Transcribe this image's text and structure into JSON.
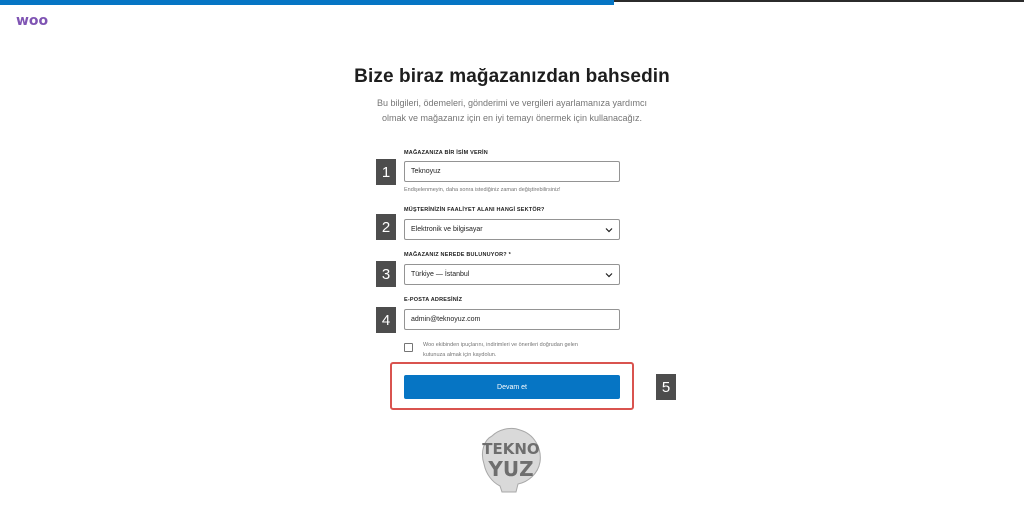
{
  "brand": {
    "logo_text": "woo",
    "logo_color": "#7f54b3",
    "accent_color": "#0675c4"
  },
  "page": {
    "title": "Bize biraz mağazanızdan bahsedin",
    "subtitle_line1": "Bu bilgileri, ödemeleri, gönderimi ve vergileri ayarlamanıza yardımcı",
    "subtitle_line2": "olmak ve mağazanız için en iyi temayı önermek için kullanacağız."
  },
  "form": {
    "store_name": {
      "label": "MAĞAZANIZA BİR İSİM VERİN",
      "value": "Teknoyuz",
      "help": "Endişelenmeyin, daha sonra istediğiniz zaman değiştirebilirsiniz!"
    },
    "industry": {
      "label": "MÜŞTERİNİZİN FAALİYET ALANI HANGİ SEKTÖR?",
      "value": "Elektronik ve bilgisayar"
    },
    "location": {
      "label": "MAĞAZANIZ NEREDE BULUNUYOR? *",
      "value": "Türkiye — İstanbul"
    },
    "email": {
      "label": "E-POSTA ADRESİNİZ",
      "value": "admin@teknoyuz.com"
    },
    "opt_in": {
      "line1": "Woo ekibinden ipuçlarını, indirimleri ve önerileri doğrudan gelen",
      "line2": "kutunuza almak için kaydolun.",
      "checked": false
    },
    "submit_label": "Devam et"
  },
  "annotations": [
    "1",
    "2",
    "3",
    "4",
    "5"
  ],
  "watermark": {
    "line1": "TEKNO",
    "line2": "YUZ"
  }
}
